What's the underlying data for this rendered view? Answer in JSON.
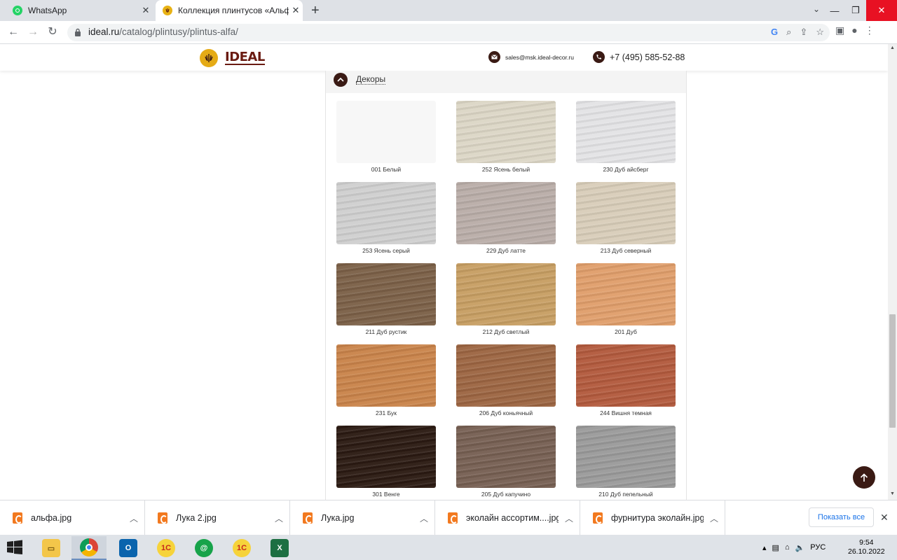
{
  "browser": {
    "tabs": [
      {
        "title": "WhatsApp",
        "favicon": "whatsapp-icon",
        "active": false
      },
      {
        "title": "Коллекция плинтусов «Альфа»",
        "favicon": "ideal-icon",
        "active": true
      }
    ],
    "url_domain": "ideal.ru",
    "url_path": "/catalog/plintusy/plintus-alfa/"
  },
  "site": {
    "logo_text": "IDEAL",
    "email": "sales@msk.ideal-decor.ru",
    "phone": "+7 (495) 585-52-88",
    "accent_color": "#3a1a14",
    "logo_color": "#e5ab16"
  },
  "catalog": {
    "section_title": "Декоры",
    "decors": [
      {
        "label": "001 Белый",
        "color": "#f7f7f7"
      },
      {
        "label": "252 Ясень белый",
        "color": "#dcd6c6"
      },
      {
        "label": "230 Дуб айсберг",
        "color": "#e3e3e5"
      },
      {
        "label": "253 Ясень серый",
        "color": "#cfcfcf"
      },
      {
        "label": "229 Дуб латте",
        "color": "#b9ada8"
      },
      {
        "label": "213 Дуб северный",
        "color": "#d8cdb9"
      },
      {
        "label": "211 Дуб рустик",
        "color": "#7b6047"
      },
      {
        "label": "212 Дуб светлый",
        "color": "#c79e63"
      },
      {
        "label": "201 Дуб",
        "color": "#e09e6b"
      },
      {
        "label": "231 Бук",
        "color": "#c9834a"
      },
      {
        "label": "206 Дуб коньячный",
        "color": "#9c6542"
      },
      {
        "label": "244 Вишня темная",
        "color": "#b25a3d"
      },
      {
        "label": "301 Венге",
        "color": "#2b1a12"
      },
      {
        "label": "205 Дуб капучино",
        "color": "#765f52"
      },
      {
        "label": "210 Дуб пепельный",
        "color": "#9a9a9a"
      }
    ]
  },
  "downloads": {
    "items": [
      "альфа.jpg",
      "Лука 2.jpg",
      "Лука.jpg",
      "эколайн ассортим....jpg",
      "фурнитура эколайн.jpg"
    ],
    "show_all_label": "Показать все"
  },
  "taskbar": {
    "language": "РУС",
    "time": "9:54",
    "date": "26.10.2022"
  }
}
